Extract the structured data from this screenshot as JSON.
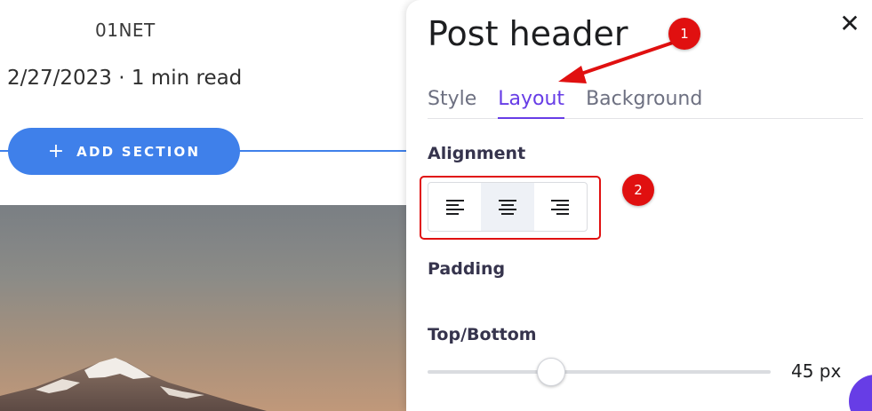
{
  "canvas": {
    "author": "01NET",
    "meta": "2/27/2023 · 1 min read",
    "add_section": {
      "icon": "plus-icon",
      "label": "ADD SECTION"
    }
  },
  "panel": {
    "title": "Post header",
    "close_icon": "close-icon",
    "tabs": [
      {
        "label": "Style",
        "active": false
      },
      {
        "label": "Layout",
        "active": true
      },
      {
        "label": "Background",
        "active": false
      }
    ],
    "alignment": {
      "label": "Alignment",
      "options": [
        {
          "icon": "align-left-icon",
          "active": false
        },
        {
          "icon": "align-center-icon",
          "active": true
        },
        {
          "icon": "align-right-icon",
          "active": false
        }
      ]
    },
    "padding_label": "Padding",
    "top_bottom": {
      "label": "Top/Bottom",
      "value": "45 px",
      "slider_fraction": 0.36
    }
  },
  "annotations": {
    "badge_1": "1",
    "badge_2": "2"
  },
  "colors": {
    "accent": "#673de6",
    "button_blue": "#3f80ea",
    "annotation_red": "#e01010"
  }
}
